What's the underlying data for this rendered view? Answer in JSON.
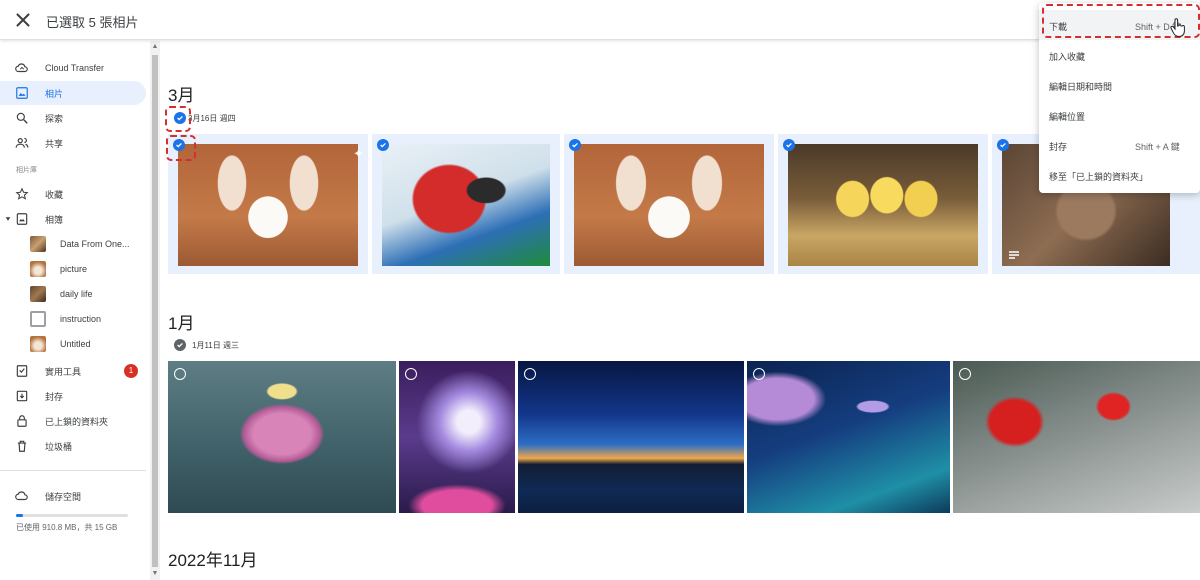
{
  "header": {
    "title": "已選取 5 張相片"
  },
  "sidebar": {
    "nav": [
      {
        "label": "Cloud Transfer",
        "icon": "cloud-sync-icon"
      },
      {
        "label": "相片",
        "icon": "photo-icon"
      },
      {
        "label": "探索",
        "icon": "search-icon"
      },
      {
        "label": "共享",
        "icon": "people-icon"
      }
    ],
    "library_label": "相片庫",
    "library": [
      {
        "label": "收藏",
        "icon": "star-icon"
      },
      {
        "label": "相簿",
        "icon": "album-icon"
      }
    ],
    "albums": [
      {
        "label": "Data From One..."
      },
      {
        "label": "picture"
      },
      {
        "label": "daily life"
      },
      {
        "label": "instruction"
      },
      {
        "label": "Untitled"
      }
    ],
    "tools": [
      {
        "label": "實用工具",
        "icon": "checklist-icon",
        "badge": "1"
      },
      {
        "label": "封存",
        "icon": "archive-icon"
      },
      {
        "label": "已上鎖的資料夾",
        "icon": "lock-icon"
      },
      {
        "label": "垃圾桶",
        "icon": "trash-icon"
      }
    ],
    "storage": {
      "label": "儲存空間",
      "used_text": "已使用 910.8 MB，共 15 GB",
      "fill_fraction": 0.06
    }
  },
  "sections": [
    {
      "title": "3月",
      "date": "3月16日 週四"
    },
    {
      "title": "1月",
      "date": "1月11日 週三"
    },
    {
      "title": "2022年11月"
    }
  ],
  "menu": {
    "items": [
      {
        "label": "下載",
        "shortcut": "Shift + D 鍵"
      },
      {
        "label": "加入收藏",
        "shortcut": ""
      },
      {
        "label": "編輯日期和時間",
        "shortcut": ""
      },
      {
        "label": "編輯位置",
        "shortcut": ""
      },
      {
        "label": "封存",
        "shortcut": "Shift + A 鍵"
      },
      {
        "label": "移至「已上鎖的資料夾」",
        "shortcut": ""
      }
    ]
  },
  "colors": {
    "accent": "#1a73e8",
    "selection_bg": "#e8f0fe",
    "highlight_dash": "#d32f2f",
    "badge": "#d93025"
  }
}
